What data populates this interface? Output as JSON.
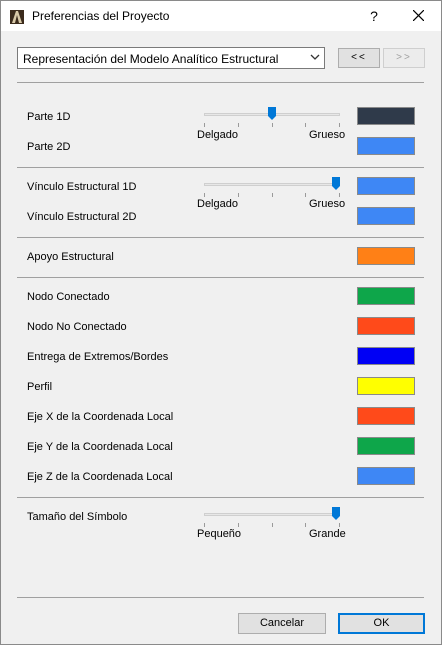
{
  "window": {
    "title": "Preferencias del Proyecto",
    "help_label": "?"
  },
  "mode_select": {
    "value": "Representación del Modelo Analítico Estructural"
  },
  "nav": {
    "prev_label": "<<",
    "next_label": ">>"
  },
  "section1": {
    "slider": {
      "min_label": "Delgado",
      "max_label": "Grueso",
      "value_percent": 50
    },
    "rows": [
      {
        "label": "Parte 1D",
        "color": "#2f3a4a"
      },
      {
        "label": "Parte 2D",
        "color": "#3e87f5"
      }
    ]
  },
  "section2": {
    "slider": {
      "min_label": "Delgado",
      "max_label": "Grueso",
      "value_percent": 100
    },
    "rows": [
      {
        "label": "Vínculo Estructural 1D",
        "color": "#3e87f5"
      },
      {
        "label": "Vínculo Estructural 2D",
        "color": "#3e87f5"
      }
    ]
  },
  "section3": {
    "rows": [
      {
        "label": "Apoyo Estructural",
        "color": "#ff8016"
      }
    ]
  },
  "section4": {
    "rows": [
      {
        "label": "Nodo Conectado",
        "color": "#0ea64a"
      },
      {
        "label": "Nodo No Conectado",
        "color": "#ff4a1a"
      },
      {
        "label": "Entrega de Extremos/Bordes",
        "color": "#0000f5"
      },
      {
        "label": "Perfil",
        "color": "#ffff00"
      },
      {
        "label": "Eje X de la Coordenada Local",
        "color": "#ff4a1a"
      },
      {
        "label": "Eje Y de la Coordenada Local",
        "color": "#0ea64a"
      },
      {
        "label": "Eje Z de la Coordenada Local",
        "color": "#3e87f5"
      }
    ]
  },
  "section5": {
    "label": "Tamaño del Símbolo",
    "slider": {
      "min_label": "Pequeño",
      "max_label": "Grande",
      "value_percent": 100
    }
  },
  "footer": {
    "cancel_label": "Cancelar",
    "ok_label": "OK"
  }
}
